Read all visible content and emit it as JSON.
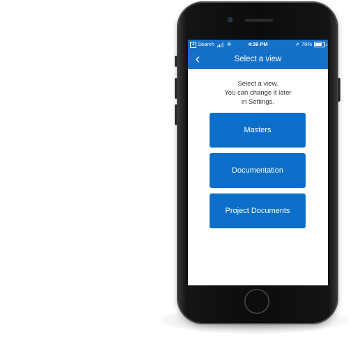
{
  "status_bar": {
    "back_label": "Search",
    "time": "4:39 PM",
    "battery_text": "76%",
    "battery_level": 0.76,
    "signal_bars": 3
  },
  "nav": {
    "back_icon": "chevron-left-icon",
    "back_glyph": "‹",
    "title": "Select a view"
  },
  "prompt": {
    "line1": "Select a view.",
    "line2": "You can change it later",
    "line3": "in Settings."
  },
  "views": [
    {
      "label": "Masters"
    },
    {
      "label": "Documentation"
    },
    {
      "label": "Project Documents"
    }
  ],
  "colors": {
    "accent": "#1570c8",
    "button": "#0b6fc9",
    "background": "#ffffff",
    "text": "#333333"
  }
}
